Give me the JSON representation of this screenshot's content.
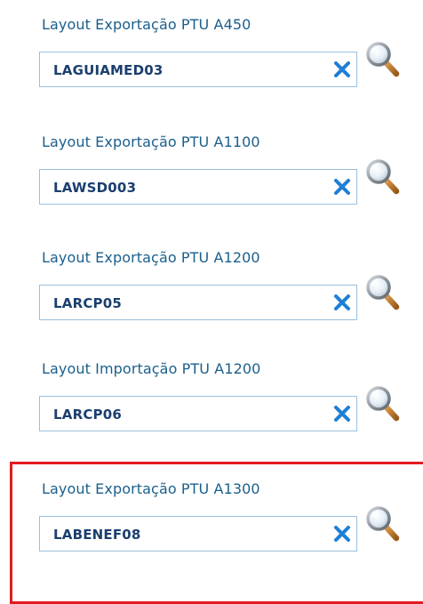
{
  "fields": [
    {
      "label": "Layout Exportação PTU A450",
      "value": "LAGUIAMED03"
    },
    {
      "label": "Layout Exportação PTU A1100",
      "value": "LAWSD003"
    },
    {
      "label": "Layout Exportação PTU A1200",
      "value": "LARCP05"
    },
    {
      "label": "Layout Importação PTU A1200",
      "value": "LARCP06"
    },
    {
      "label": "Layout Exportação PTU A1300",
      "value": "LABENEF08"
    }
  ],
  "icons": {
    "clear": "close-icon",
    "lookup": "search-icon"
  },
  "colors": {
    "label_text": "#1a5f8c",
    "value_text": "#1b3f6e",
    "field_border": "#9cc0dc",
    "clear_icon": "#1e7fd6",
    "highlight": "#e11b22"
  }
}
